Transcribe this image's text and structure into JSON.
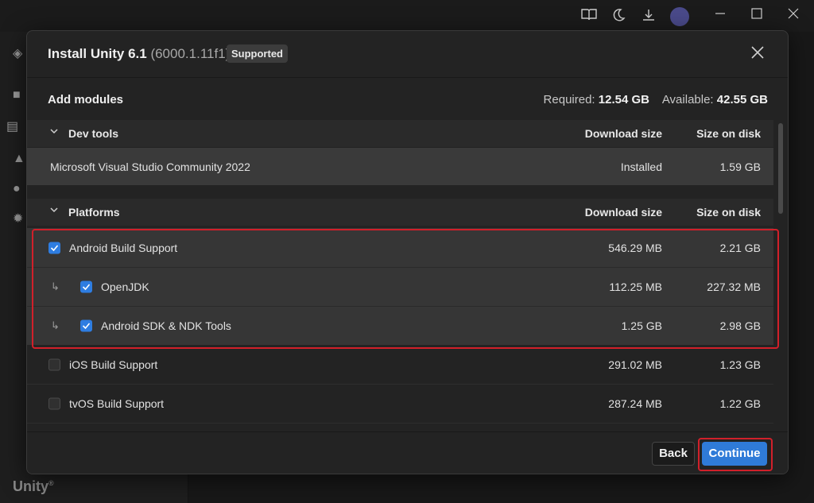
{
  "dialog": {
    "title": "Install Unity 6.1",
    "version": "(6000.1.11f1)",
    "badge": "Supported"
  },
  "modules": {
    "heading": "Add modules",
    "required_label": "Required:",
    "required_value": "12.54 GB",
    "available_label": "Available:",
    "available_value": "42.55 GB"
  },
  "sections": [
    {
      "name": "Dev tools",
      "col_download": "Download size",
      "col_disk": "Size on disk",
      "rows": [
        {
          "name": "Microsoft Visual Studio Community 2022",
          "download": "Installed",
          "disk": "1.59 GB"
        }
      ]
    },
    {
      "name": "Platforms",
      "col_download": "Download size",
      "col_disk": "Size on disk",
      "rows": [
        {
          "name": "Android Build Support",
          "download": "546.29 MB",
          "disk": "2.21 GB",
          "checked": true
        },
        {
          "name": "OpenJDK",
          "download": "112.25 MB",
          "disk": "227.32 MB",
          "checked": true,
          "sub": true
        },
        {
          "name": "Android SDK & NDK Tools",
          "download": "1.25 GB",
          "disk": "2.98 GB",
          "checked": true,
          "sub": true
        },
        {
          "name": "iOS Build Support",
          "download": "291.02 MB",
          "disk": "1.23 GB",
          "checked": false
        },
        {
          "name": "tvOS Build Support",
          "download": "287.24 MB",
          "disk": "1.22 GB",
          "checked": false
        }
      ]
    }
  ],
  "footer": {
    "back_label": "Back",
    "continue_label": "Continue"
  },
  "background": {
    "brand": "Unity"
  },
  "colors": {
    "accent": "#2f7bd8",
    "highlight": "#d1202a",
    "checkbox": "#2e7de1"
  },
  "icons": [
    "book-icon",
    "moon-icon",
    "download-icon",
    "avatar",
    "minimize-icon",
    "maximize-icon",
    "close-icon",
    "chevron-down-icon",
    "check-icon",
    "sub-item-arrow-icon"
  ]
}
